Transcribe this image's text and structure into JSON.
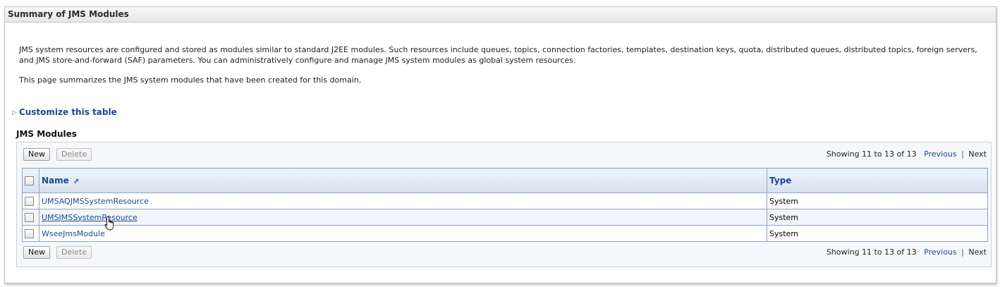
{
  "panel": {
    "title": "Summary of JMS Modules"
  },
  "description": {
    "paragraph1": "JMS system resources are configured and stored as modules similar to standard J2EE modules. Such resources include queues, topics, connection factories, templates, destination keys, quota, distributed queues, distributed topics, foreign servers, and JMS store-and-forward (SAF) parameters. You can administratively configure and manage JMS system modules as global system resources.",
    "paragraph2": "This page summarizes the JMS system modules that have been created for this domain."
  },
  "customize": {
    "label": "Customize this table",
    "icon": "expand-triangle-icon"
  },
  "table": {
    "title": "JMS Modules",
    "new_label": "New",
    "delete_label": "Delete",
    "pager": {
      "showing": "Showing 11 to 13 of 13",
      "previous": "Previous",
      "separator": "|",
      "next": "Next"
    },
    "columns": {
      "name": "Name",
      "type": "Type",
      "sort_icon": "sort-ascending-icon"
    },
    "rows": [
      {
        "name": "UMSAQJMSSystemResource",
        "type": "System"
      },
      {
        "name": "UMSJMSSystemResource",
        "type": "System"
      },
      {
        "name": "WseeJmsModule",
        "type": "System"
      }
    ]
  },
  "colors": {
    "link": "#1b4a90",
    "header_bg": "#d7e2ef",
    "grid_border": "#8fa6c2"
  }
}
